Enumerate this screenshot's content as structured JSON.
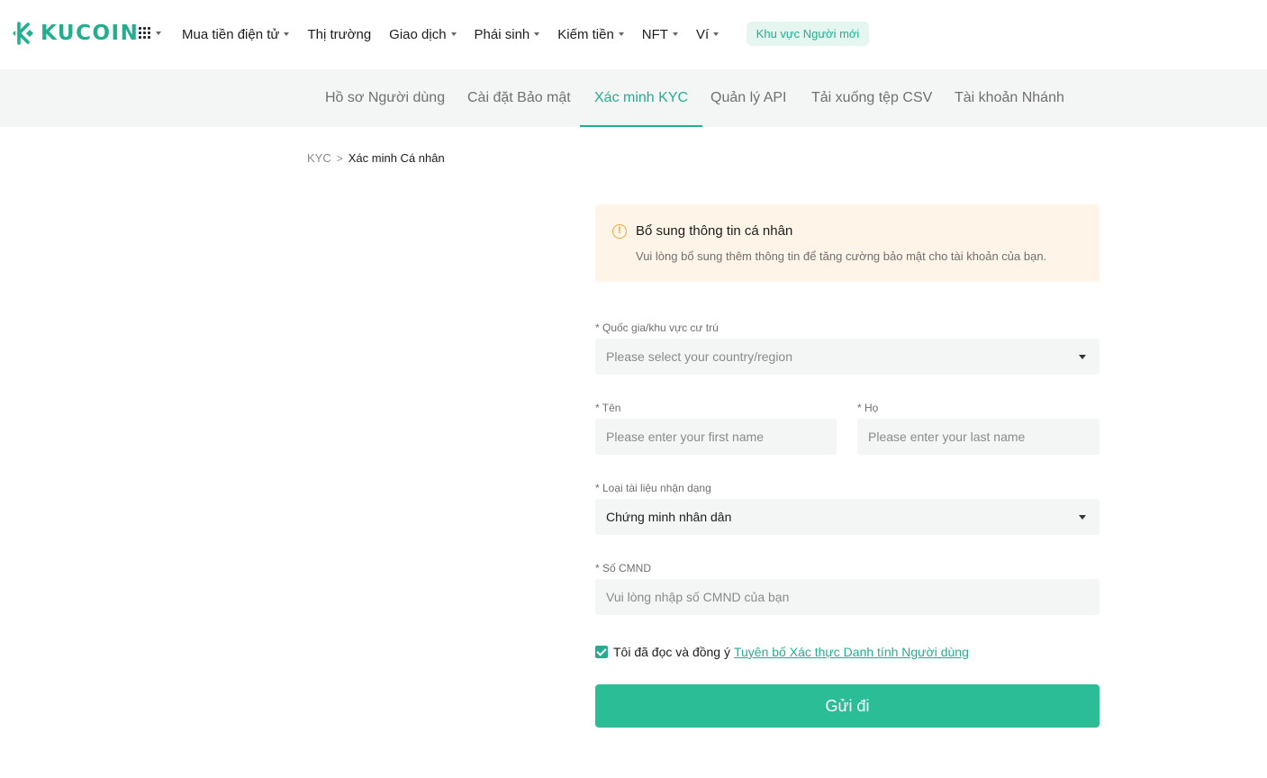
{
  "brand": {
    "name": "KUCOIN",
    "color": "#24ae8f"
  },
  "topnav": {
    "apps_icon": "grid-icon",
    "items": [
      {
        "label": "Mua tiền điện tử",
        "has_caret": true
      },
      {
        "label": "Thị trường",
        "has_caret": false
      },
      {
        "label": "Giao dịch",
        "has_caret": true
      },
      {
        "label": "Phái sinh",
        "has_caret": true
      },
      {
        "label": "Kiếm tiền",
        "has_caret": true
      },
      {
        "label": "NFT",
        "has_caret": true
      },
      {
        "label": "Ví",
        "has_caret": true
      }
    ],
    "newbie_label": "Khu vực Người mới"
  },
  "subnav": {
    "tabs": [
      {
        "label": "Hồ sơ Người dùng"
      },
      {
        "label": "Cài đặt Bảo mật"
      },
      {
        "label": "Xác minh KYC",
        "active": true
      },
      {
        "label": "Quản lý API"
      },
      {
        "label": "Tải xuống tệp CSV"
      },
      {
        "label": "Tài khoản Nhánh"
      }
    ]
  },
  "breadcrumb": {
    "root": "KYC",
    "separator": ">",
    "current": "Xác minh Cá nhân"
  },
  "notice": {
    "icon": "info-circle-icon",
    "title": "Bổ sung thông tin cá nhân",
    "text": "Vui lòng bổ sung thêm thông tin để tăng cường bảo mật cho tài khoản của bạn."
  },
  "form": {
    "country": {
      "label": "* Quốc gia/khu vực cư trú",
      "placeholder": "Please select your country/region"
    },
    "first_name": {
      "label": "* Tên",
      "placeholder": "Please enter your first name"
    },
    "last_name": {
      "label": "* Họ",
      "placeholder": "Please enter your last name"
    },
    "id_type": {
      "label": "* Loại tài liệu nhận dạng",
      "value": "Chứng minh nhân dân"
    },
    "id_number": {
      "label": "* Số CMND",
      "placeholder": "Vui lòng nhập số CMND của bạn"
    },
    "agree": {
      "checked": true,
      "text": "Tôi đã đọc và đồng ý",
      "link": "Tuyên bố Xác thực Danh tính Người dùng"
    },
    "submit_label": "Gửi đi"
  },
  "colors": {
    "accent": "#24ae8f",
    "button": "#2bbd96",
    "notice_bg": "#fef4e7",
    "warning": "#f3a43b"
  }
}
